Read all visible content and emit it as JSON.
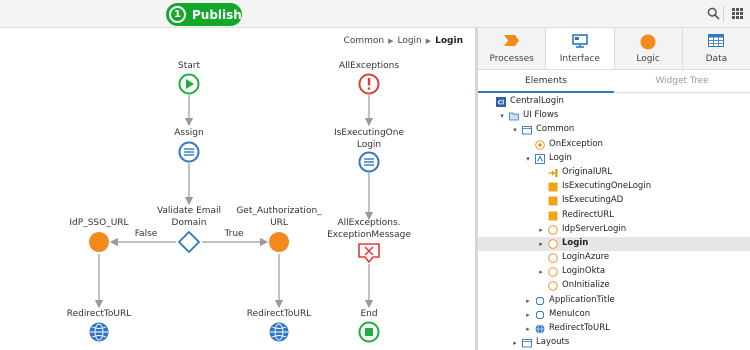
{
  "toolbar": {
    "publish_number": "1",
    "publish_label": "Publish"
  },
  "breadcrumb": {
    "items": [
      "Common",
      "Login"
    ],
    "current": "Login"
  },
  "flow": {
    "start": "Start",
    "assign": "Assign",
    "validate_line1": "Validate Email",
    "validate_line2": "Domain",
    "false_label": "False",
    "true_label": "True",
    "idp_url": "IdP_SSO_URL",
    "get_auth_line1": "Get_Authorization_",
    "get_auth_line2": "URL",
    "redirect_left": "RedirectToURL",
    "redirect_right": "RedirectToURL",
    "all_exceptions": "AllExceptions",
    "is_exec_line1": "IsExecutingOne",
    "is_exec_line2": "Login",
    "exc_msg_line1": "AllExceptions.",
    "exc_msg_line2": "ExceptionMessage",
    "end": "End"
  },
  "panel": {
    "tabs": [
      "Processes",
      "Interface",
      "Logic",
      "Data"
    ],
    "active_tab": "Interface",
    "subtabs": [
      "Elements",
      "Widget Tree"
    ],
    "active_subtab": "Elements"
  },
  "tree": [
    {
      "label": "CentralLogin",
      "depth": 0,
      "toggle": "",
      "icon": "module-icon"
    },
    {
      "label": "UI Flows",
      "depth": 1,
      "toggle": "open",
      "icon": "folder-icon"
    },
    {
      "label": "Common",
      "depth": 2,
      "toggle": "open",
      "icon": "flow-icon"
    },
    {
      "label": "OnException",
      "depth": 3,
      "toggle": "",
      "icon": "exception-handler-icon"
    },
    {
      "label": "Login",
      "depth": 3,
      "toggle": "open",
      "icon": "screen-icon"
    },
    {
      "label": "OriginalURL",
      "depth": 4,
      "toggle": "",
      "icon": "input-parameter-icon"
    },
    {
      "label": "IsExecutingOneLogin",
      "depth": 4,
      "toggle": "",
      "icon": "local-variable-icon"
    },
    {
      "label": "IsExecutingAD",
      "depth": 4,
      "toggle": "",
      "icon": "local-variable-icon"
    },
    {
      "label": "RedirectURL",
      "depth": 4,
      "toggle": "",
      "icon": "local-variable-icon"
    },
    {
      "label": "IdpServerLogin",
      "depth": 4,
      "toggle": "closed",
      "icon": "action-icon"
    },
    {
      "label": "Login",
      "depth": 4,
      "toggle": "closed",
      "icon": "action-icon",
      "selected": true
    },
    {
      "label": "LoginAzure",
      "depth": 4,
      "toggle": "",
      "icon": "action-icon"
    },
    {
      "label": "LoginOkta",
      "depth": 4,
      "toggle": "closed",
      "icon": "action-icon"
    },
    {
      "label": "OnInitialize",
      "depth": 4,
      "toggle": "",
      "icon": "action-icon"
    },
    {
      "label": "ApplicationTitle",
      "depth": 3,
      "toggle": "closed",
      "icon": "block-icon"
    },
    {
      "label": "MenuIcon",
      "depth": 3,
      "toggle": "closed",
      "icon": "block-icon"
    },
    {
      "label": "RedirectToURL",
      "depth": 3,
      "toggle": "closed",
      "icon": "globe-icon"
    },
    {
      "label": "Layouts",
      "depth": 2,
      "toggle": "closed",
      "icon": "flow-icon"
    }
  ],
  "colors": {
    "publish": "#14a82b",
    "start": "#1eae3e",
    "assign": "#2f76c5",
    "if": "#2f76c5",
    "orange": "#f48a1b",
    "exception": "#e53935",
    "selected_row": "#e6e6e6",
    "active_underline": "#2a78c8"
  }
}
